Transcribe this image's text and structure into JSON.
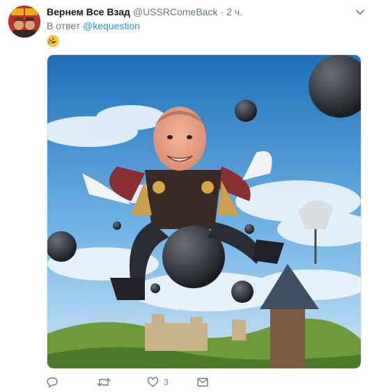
{
  "tweet": {
    "author_name": "Вернем Все Взад",
    "author_handle": "@USSRComeBack",
    "separator": "·",
    "timestamp": "2 ч.",
    "reply_prefix": "В ответ",
    "reply_to": "@kequestion",
    "emoji_icon": "rolling-on-floor-laughing-icon",
    "avatar_bg": "#c0392b"
  },
  "actions": {
    "reply_icon": "reply-icon",
    "retweet_icon": "retweet-icon",
    "like_icon": "heart-icon",
    "like_count": "3",
    "dm_icon": "mail-icon"
  },
  "colors": {
    "text": "#14171a",
    "secondary": "#657786",
    "link": "#1b95e0"
  }
}
